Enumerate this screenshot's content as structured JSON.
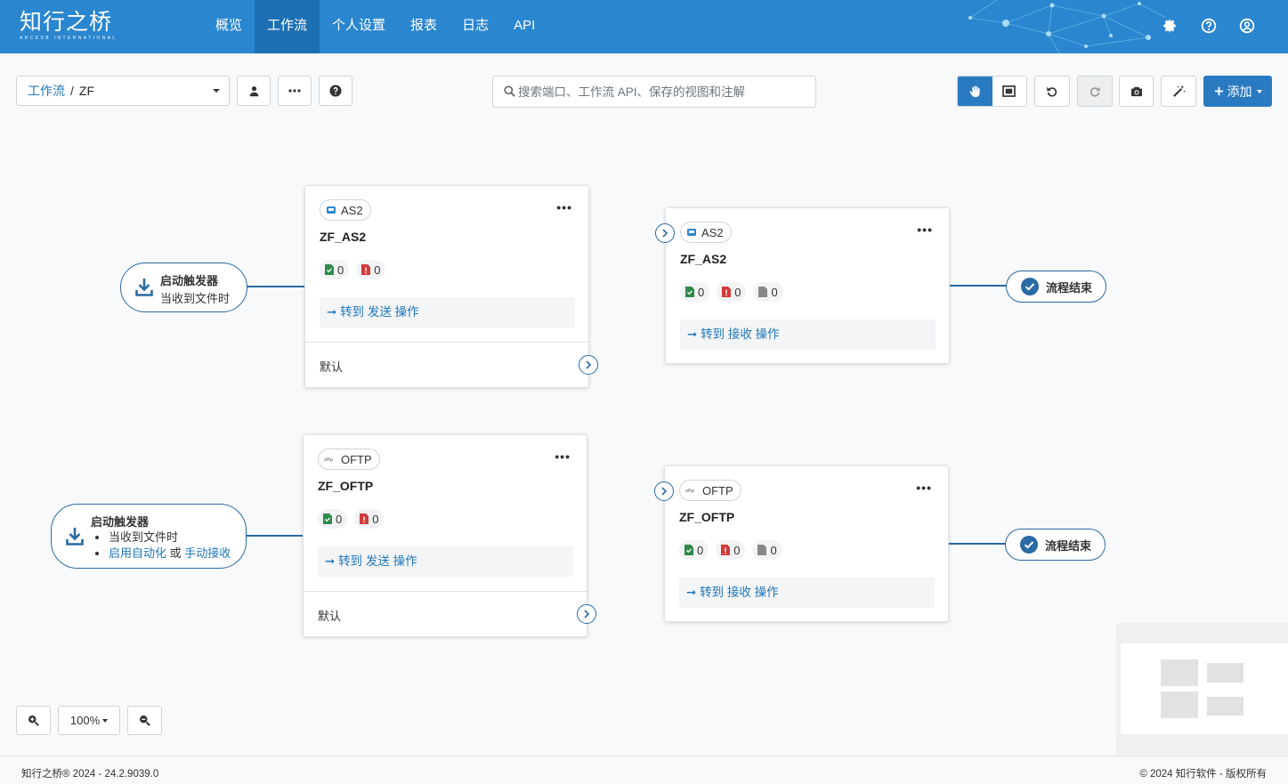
{
  "header": {
    "logo_main": "知行之桥",
    "logo_sub": "ARCESB INTERNATIONAL",
    "nav": [
      "概览",
      "工作流",
      "个人设置",
      "报表",
      "日志",
      "API"
    ],
    "active_nav": "工作流",
    "icons": [
      "gear-icon",
      "help-icon",
      "user-icon"
    ]
  },
  "toolbar": {
    "breadcrumb_root": "工作流",
    "breadcrumb_sep": "/",
    "breadcrumb_current": "ZF",
    "search_placeholder": "搜索端口、工作流 API、保存的视图和注解",
    "add_label": "添加"
  },
  "flows": [
    {
      "trigger_title": "启动触发器",
      "trigger_sub": "当收到文件时",
      "send_card": {
        "type": "AS2",
        "name": "ZF_AS2",
        "success": "0",
        "error": "0",
        "goto_text": "转到 发送 操作",
        "default_label": "默认"
      },
      "receive_card": {
        "type": "AS2",
        "name": "ZF_AS2",
        "success": "0",
        "error": "0",
        "pending": "0",
        "goto_text": "转到 接收 操作"
      },
      "end_label": "流程结束"
    },
    {
      "trigger_title": "启动触发器",
      "trigger_items": [
        "当收到文件时"
      ],
      "trigger_link1": "启用自动化",
      "trigger_or": "或",
      "trigger_link2": "手动接收",
      "send_card": {
        "type": "OFTP",
        "name": "ZF_OFTP",
        "success": "0",
        "error": "0",
        "goto_text": "转到 发送 操作",
        "default_label": "默认"
      },
      "receive_card": {
        "type": "OFTP",
        "name": "ZF_OFTP",
        "success": "0",
        "error": "0",
        "pending": "0",
        "goto_text": "转到 接收 操作"
      },
      "end_label": "流程结束"
    }
  ],
  "zoom": {
    "level": "100%"
  },
  "footer": {
    "left": "知行之桥® 2024 - 24.2.9039.0",
    "right": "© 2024 知行软件 - 版权所有"
  },
  "colors": {
    "header": "#2a86cf",
    "active_nav": "#1c6fb3",
    "primary": "#2a7ac2",
    "link": "#1f77b8",
    "success": "#2f8a4a",
    "error": "#d33a3a"
  }
}
